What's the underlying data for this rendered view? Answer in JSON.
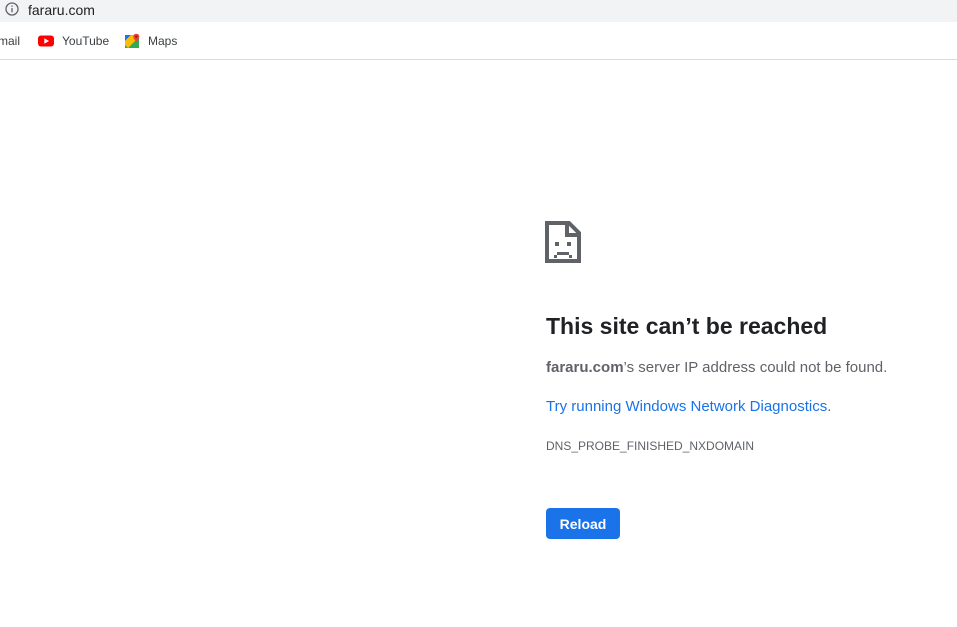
{
  "browser": {
    "url": "fararu.com",
    "bookmarks": [
      {
        "label": "mail",
        "icon": "gmail-icon"
      },
      {
        "label": "YouTube",
        "icon": "youtube-icon"
      },
      {
        "label": "Maps",
        "icon": "maps-icon"
      }
    ]
  },
  "error_page": {
    "icon": "sad-page-icon",
    "title": "This site can’t be reached",
    "host": "fararu.com",
    "description_suffix": "’s server IP address could not be found.",
    "diagnostics_link": "Try running Windows Network Diagnostics",
    "diagnostics_suffix": ".",
    "error_code": "DNS_PROBE_FINISHED_NXDOMAIN",
    "reload_label": "Reload"
  },
  "colors": {
    "accent": "#1a73e8",
    "text_primary": "#202124",
    "text_secondary": "#5f6368",
    "omnibox_bg": "#f1f3f4"
  }
}
